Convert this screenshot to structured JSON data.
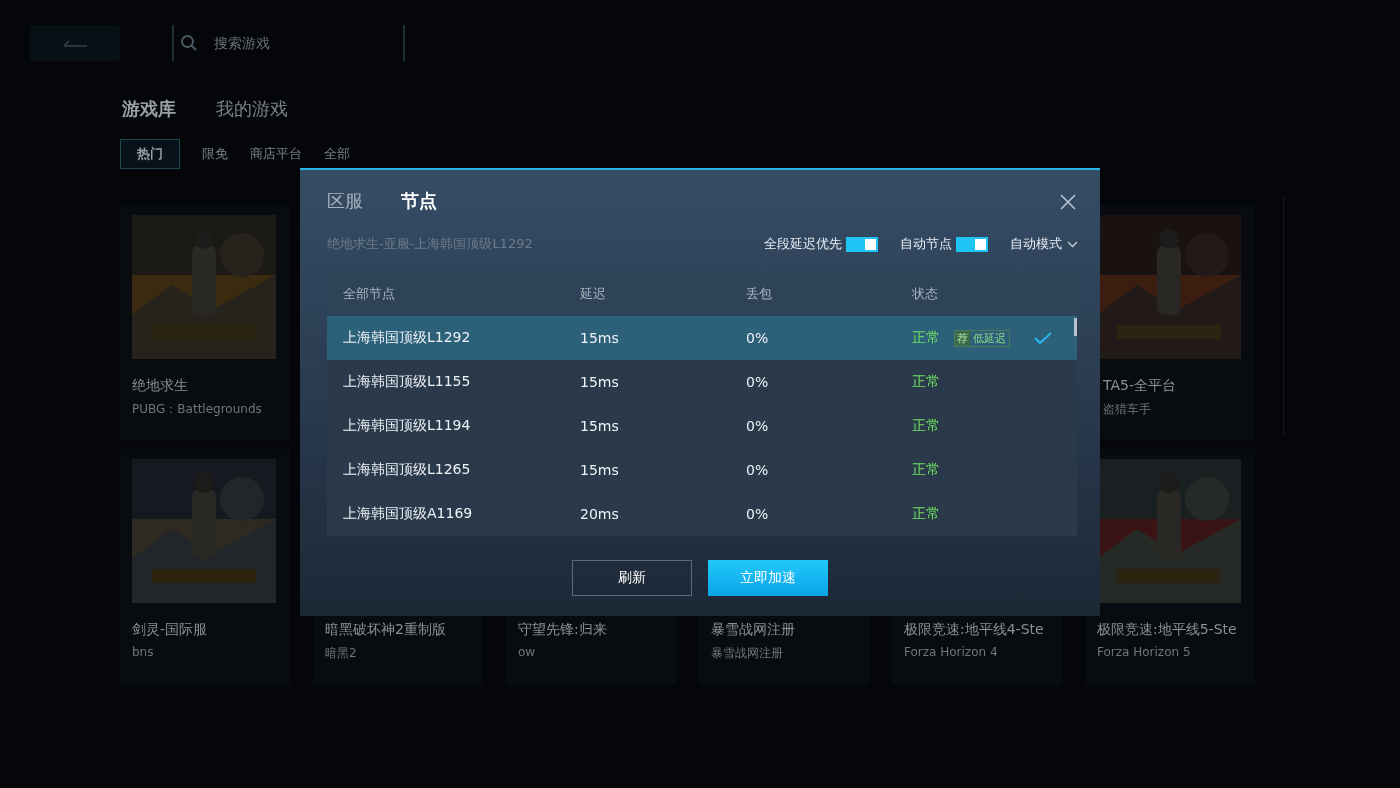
{
  "topbar": {
    "search": {
      "placeholder": "搜索游戏"
    }
  },
  "library_tabs": [
    {
      "label": "游戏库",
      "selected": true
    },
    {
      "label": "我的游戏",
      "selected": false
    }
  ],
  "filters": [
    {
      "label": "热门",
      "selected": true
    },
    {
      "label": "限免",
      "selected": false
    },
    {
      "label": "商店平台",
      "selected": false
    },
    {
      "label": "全部",
      "selected": false
    }
  ],
  "card_rows": [
    [
      {
        "kind": "picture",
        "title": "绝地求生",
        "subtitle": "PUBG：Battlegrounds"
      },
      {},
      {},
      {},
      {},
      {
        "kind": "picture",
        "title": "TA5-全平台",
        "subtitle": "盗猎车手"
      }
    ],
    [
      {
        "kind": "picture",
        "title": "剑灵-国际服",
        "subtitle": "bns"
      },
      {
        "title": "暗黑破坏神2重制版",
        "subtitle": "暗黑2"
      },
      {
        "title": "守望先锋:归来",
        "subtitle": "ow"
      },
      {
        "title": "暴雪战网注册",
        "subtitle": "暴雪战网注册"
      },
      {
        "title": "极限竞速:地平线4-Ste",
        "subtitle": "Forza Horizon 4"
      },
      {
        "kind": "picture",
        "title": "极限竞速:地平线5-Ste",
        "subtitle": "Forza Horizon 5"
      }
    ]
  ],
  "dialog": {
    "tabs": [
      {
        "label": "区服",
        "selected": false
      },
      {
        "label": "节点",
        "selected": true
      }
    ],
    "path": "绝地求生-亚服-上海韩国顶级L1292",
    "toggles": [
      {
        "label": "全段延迟优先",
        "on": true
      },
      {
        "label": "自动节点",
        "on": true
      }
    ],
    "mode": "自动模式",
    "columns": [
      "全部节点",
      "延迟",
      "丢包",
      "状态"
    ],
    "rows": [
      {
        "node": "上海韩国顶级L1292",
        "latency": "15ms",
        "loss": "0%",
        "status": "正常",
        "selected": true,
        "badge": {
          "mark": "荐",
          "text": "低延迟"
        }
      },
      {
        "node": "上海韩国顶级L1155",
        "latency": "15ms",
        "loss": "0%",
        "status": "正常",
        "selected": false
      },
      {
        "node": "上海韩国顶级L1194",
        "latency": "15ms",
        "loss": "0%",
        "status": "正常",
        "selected": false
      },
      {
        "node": "上海韩国顶级L1265",
        "latency": "15ms",
        "loss": "0%",
        "status": "正常",
        "selected": false
      },
      {
        "node": "上海韩国顶级A1169",
        "latency": "20ms",
        "loss": "0%",
        "status": "正常",
        "selected": false
      }
    ],
    "buttons": [
      {
        "label": "刷新",
        "kind": "secondary"
      },
      {
        "label": "立即加速",
        "kind": "primary"
      }
    ]
  }
}
